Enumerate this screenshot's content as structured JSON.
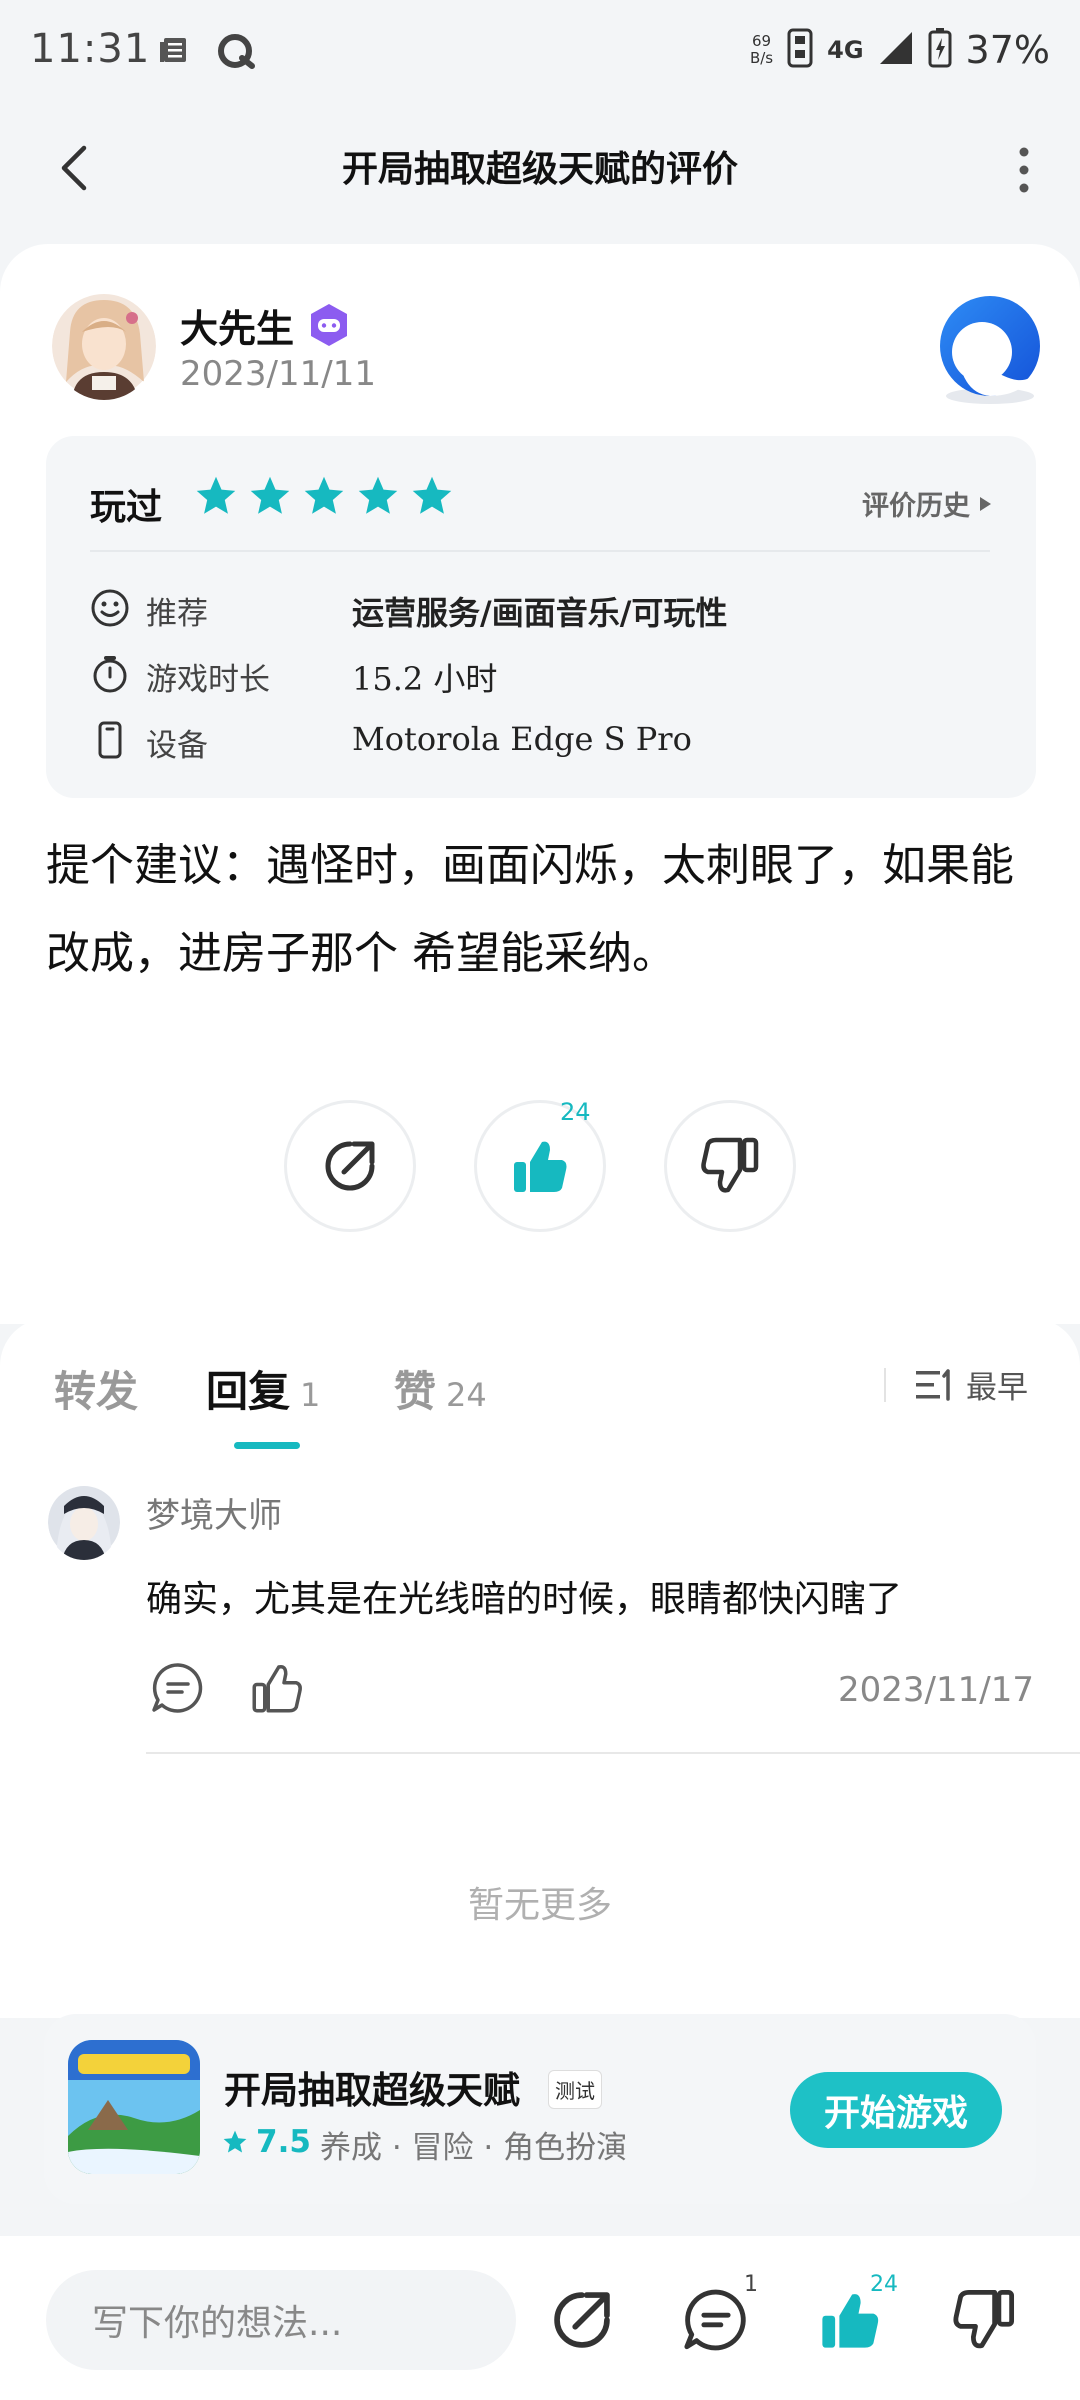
{
  "status_bar": {
    "time": "11:31",
    "net_speed_value": "69",
    "net_speed_unit": "B/s",
    "network": "4G",
    "battery": "37%"
  },
  "nav": {
    "title": "开局抽取超级天赋的评价"
  },
  "review": {
    "user_name": "大先生",
    "date": "2023/11/11",
    "played_label": "玩过",
    "stars": 5,
    "history_label": "评价历史",
    "rows": [
      {
        "label": "推荐",
        "value": "运营服务/画面音乐/可玩性",
        "icon": "smile-icon"
      },
      {
        "label": "游戏时长",
        "value": "15.2 小时",
        "icon": "timer-icon"
      },
      {
        "label": "设备",
        "value": "Motorola Edge S Pro",
        "icon": "phone-icon"
      }
    ],
    "text": "提个建议：遇怪时，画面闪烁，太刺眼了，如果能改成，进房子那个 希望能采纳。",
    "like_count": "24"
  },
  "tabs": {
    "forward": "转发",
    "reply": "回复",
    "reply_count": "1",
    "like": "赞",
    "like_count": "24",
    "sort_label": "最早"
  },
  "reply": {
    "name": "梦境大师",
    "text": "确实，尤其是在光线暗的时候，眼睛都快闪瞎了",
    "date": "2023/11/17"
  },
  "no_more": "暂无更多",
  "game": {
    "title": "开局抽取超级天赋",
    "badge": "测试",
    "rating": "7.5",
    "tags": "养成 · 冒险 · 角色扮演",
    "play_label": "开始游戏"
  },
  "bottom_bar": {
    "input_placeholder": "写下你的想法...",
    "comment_count": "1",
    "like_count": "24"
  },
  "colors": {
    "accent": "#16b9c0",
    "play_button": "#1ec1c6"
  }
}
